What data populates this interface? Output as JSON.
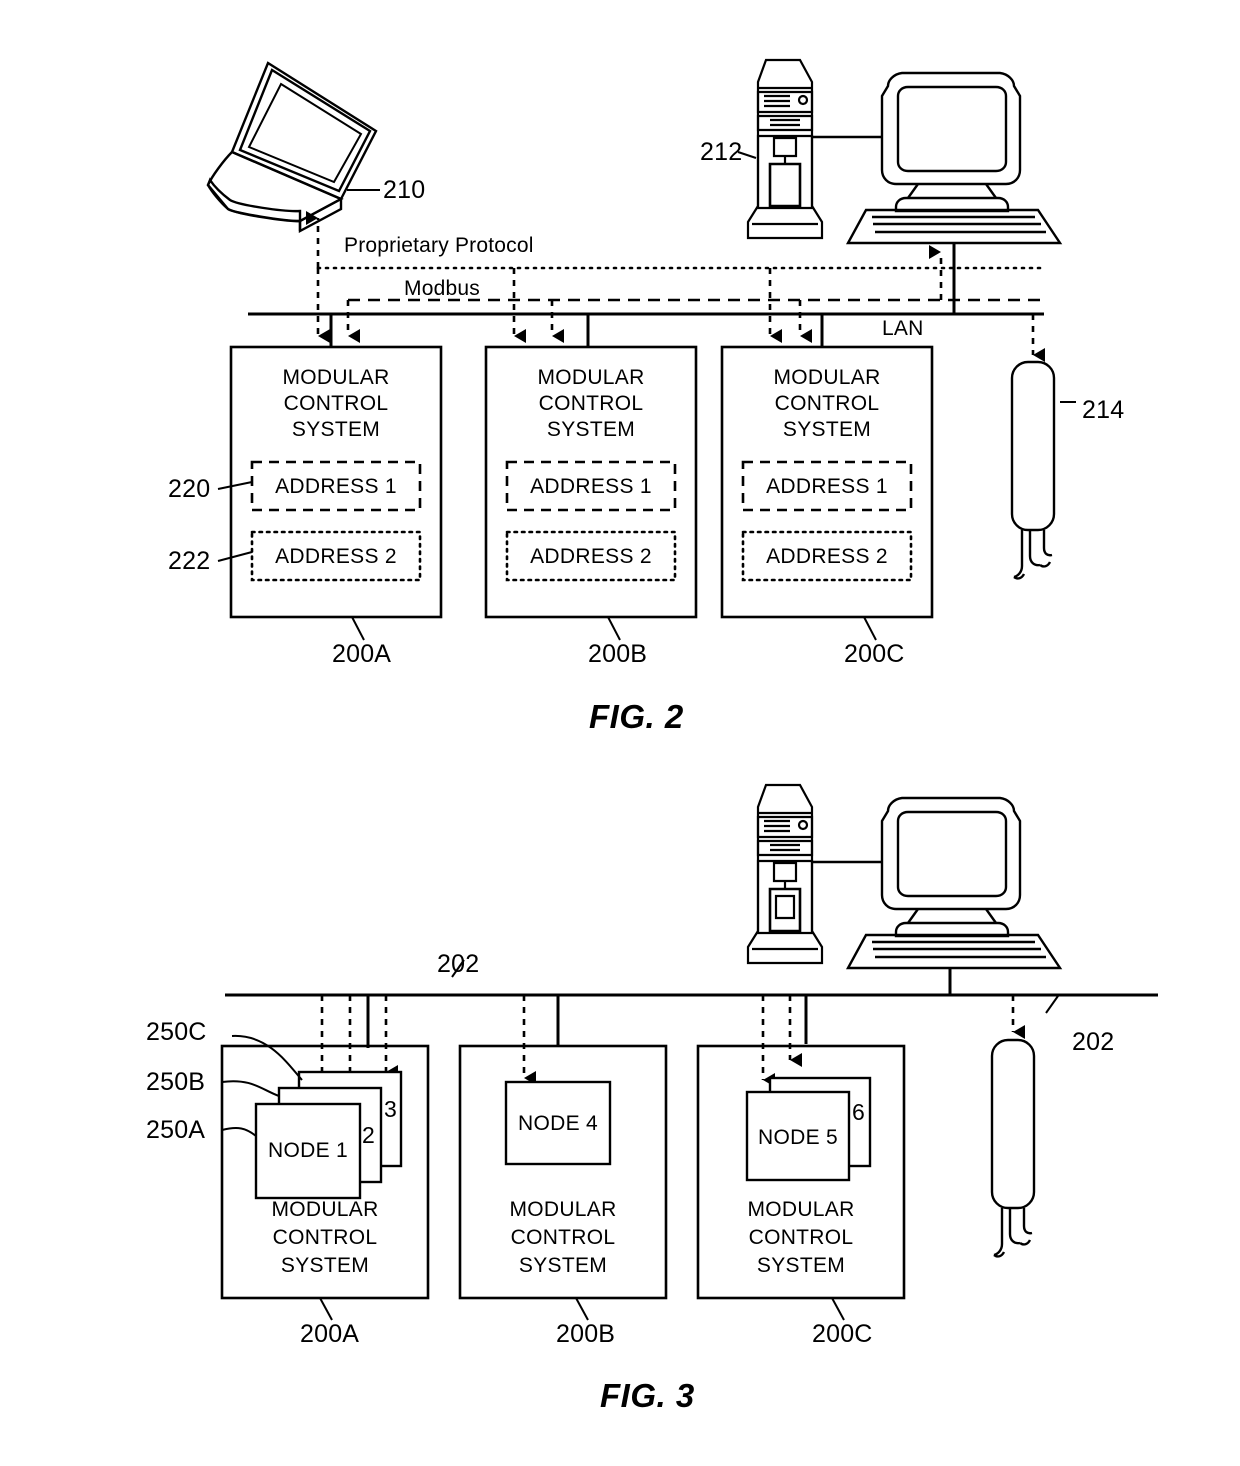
{
  "document": {
    "type": "patent-drawing-sheet",
    "figures": [
      "FIG. 2",
      "FIG. 3"
    ]
  },
  "fig2": {
    "caption": "FIG. 2",
    "devices": {
      "laptop": {
        "ref": "210",
        "icon": "laptop-icon"
      },
      "tower": {
        "ref": "212",
        "icon": "computer-tower-icon"
      },
      "monitor": {
        "icon": "crt-monitor-icon"
      },
      "keyboard": {
        "icon": "keyboard-icon"
      },
      "probe": {
        "ref": "214",
        "icon": "sensor-probe-icon"
      }
    },
    "bus": {
      "lan_label": "LAN",
      "protocol_labels": {
        "proprietary": "Proprietary Protocol",
        "modbus": "Modbus"
      }
    },
    "systems": [
      {
        "ref": "200A",
        "title": [
          "MODULAR",
          "CONTROL",
          "SYSTEM"
        ],
        "addresses": [
          {
            "ref": "220",
            "label": "ADDRESS 1",
            "border": "dashed"
          },
          {
            "ref": "222",
            "label": "ADDRESS 2",
            "border": "dotted"
          }
        ]
      },
      {
        "ref": "200B",
        "title": [
          "MODULAR",
          "CONTROL",
          "SYSTEM"
        ],
        "addresses": [
          {
            "ref": "",
            "label": "ADDRESS 1",
            "border": "dashed"
          },
          {
            "ref": "",
            "label": "ADDRESS 2",
            "border": "dotted"
          }
        ]
      },
      {
        "ref": "200C",
        "title": [
          "MODULAR",
          "CONTROL",
          "SYSTEM"
        ],
        "addresses": [
          {
            "ref": "",
            "label": "ADDRESS 1",
            "border": "dashed"
          },
          {
            "ref": "",
            "label": "ADDRESS 2",
            "border": "dotted"
          }
        ]
      }
    ]
  },
  "fig3": {
    "caption": "FIG. 3",
    "devices": {
      "tower": {
        "icon": "computer-tower-icon"
      },
      "monitor": {
        "icon": "crt-monitor-icon"
      },
      "keyboard": {
        "icon": "keyboard-icon"
      },
      "probe": {
        "icon": "sensor-probe-icon"
      }
    },
    "bus": {
      "ref_left": "202",
      "ref_right": "202"
    },
    "systems": [
      {
        "ref": "200A",
        "title": [
          "MODULAR",
          "CONTROL",
          "SYSTEM"
        ],
        "nodes": [
          {
            "ref": "250A",
            "label": "NODE 1",
            "tab": ""
          },
          {
            "ref": "250B",
            "label": "",
            "tab": "2"
          },
          {
            "ref": "250C",
            "label": "",
            "tab": "3"
          }
        ]
      },
      {
        "ref": "200B",
        "title": [
          "MODULAR",
          "CONTROL",
          "SYSTEM"
        ],
        "nodes": [
          {
            "ref": "",
            "label": "NODE 4",
            "tab": ""
          }
        ]
      },
      {
        "ref": "200C",
        "title": [
          "MODULAR",
          "CONTROL",
          "SYSTEM"
        ],
        "nodes": [
          {
            "ref": "",
            "label": "NODE 5",
            "tab": ""
          },
          {
            "ref": "",
            "label": "",
            "tab": "6"
          }
        ]
      }
    ]
  }
}
